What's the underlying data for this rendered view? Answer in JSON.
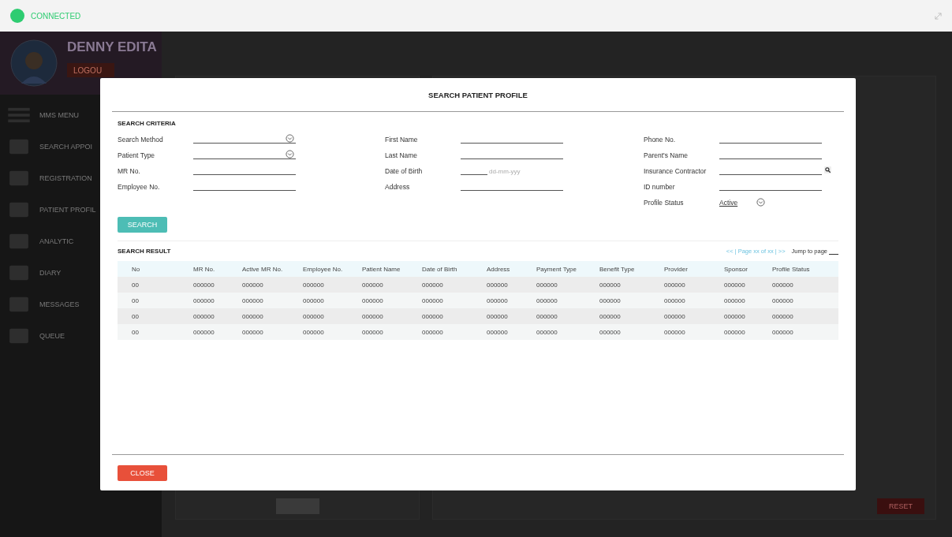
{
  "status": {
    "label": "CONNECTED",
    "connected": true
  },
  "user": {
    "name": "DENNY EDITA",
    "logout": "LOGOU"
  },
  "menu": [
    {
      "label": "MMS MENU"
    },
    {
      "label": "SEARCH APPOI"
    },
    {
      "label": "REGISTRATION"
    },
    {
      "label": "PATIENT PROFIL"
    },
    {
      "label": "ANALYTIC"
    },
    {
      "label": "DIARY"
    },
    {
      "label": "MESSAGES"
    },
    {
      "label": "QUEUE"
    }
  ],
  "background": {
    "reset_button": "RESET"
  },
  "dialog": {
    "title": "SEARCH PATIENT PROFILE",
    "criteria_heading": "SEARCH CRITERIA",
    "field_columns": [
      [
        {
          "label": "Search Method",
          "kind": "dropdown"
        },
        {
          "label": "Patient Type",
          "kind": "dropdown"
        },
        {
          "label": "MR No.",
          "kind": "text"
        },
        {
          "label": "Employee No.",
          "kind": "text"
        }
      ],
      [
        {
          "label": "First Name",
          "kind": "text"
        },
        {
          "label": "Last Name",
          "kind": "text"
        },
        {
          "label": "Date of Birth",
          "kind": "date",
          "placeholder": "dd-mm-yyy"
        },
        {
          "label": "Address",
          "kind": "text"
        }
      ],
      [
        {
          "label": "Phone No.",
          "kind": "text"
        },
        {
          "label": "Parent's Name",
          "kind": "text"
        },
        {
          "label": "Insurance Contractor",
          "kind": "lookup"
        },
        {
          "label": "ID number",
          "kind": "text"
        },
        {
          "label": "Profile Status",
          "kind": "select",
          "value": "Active"
        }
      ]
    ],
    "search_button": "SEARCH",
    "result_heading": "SEARCH RESULT",
    "pager": "<< | Page xx of xx | >>",
    "jump_label": "Jump to page",
    "table": {
      "columns": [
        "No",
        "MR No.",
        "Active MR No.",
        "Employee No.",
        "Patient Name",
        "Date of Birth",
        "Address",
        "Payment Type",
        "Benefit Type",
        "Provider",
        "Sponsor",
        "Profile Status"
      ],
      "rows": [
        [
          "00",
          "000000",
          "000000",
          "000000",
          "000000",
          "000000",
          "000000",
          "000000",
          "000000",
          "000000",
          "000000",
          "000000"
        ],
        [
          "00",
          "000000",
          "000000",
          "000000",
          "000000",
          "000000",
          "000000",
          "000000",
          "000000",
          "000000",
          "000000",
          "000000"
        ],
        [
          "00",
          "000000",
          "000000",
          "000000",
          "000000",
          "000000",
          "000000",
          "000000",
          "000000",
          "000000",
          "000000",
          "000000"
        ],
        [
          "00",
          "000000",
          "000000",
          "000000",
          "000000",
          "000000",
          "000000",
          "000000",
          "000000",
          "000000",
          "000000",
          "000000"
        ]
      ]
    },
    "close_button": "CLOSE"
  }
}
